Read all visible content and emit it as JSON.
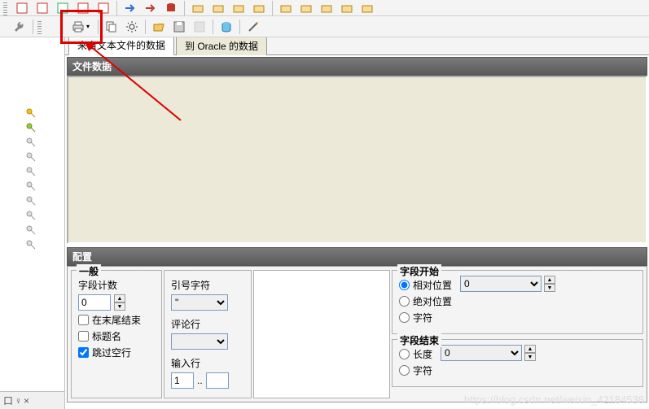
{
  "toolbar2": {
    "highlighted_button": "print-dropdown"
  },
  "tabs": {
    "from_text": "来自文本文件的数据",
    "to_oracle": "到 Oracle 的数据"
  },
  "sections": {
    "file_data": "文件数据",
    "config": "配置"
  },
  "config": {
    "general": {
      "legend": "一般",
      "field_count_label": "字段计数",
      "field_count_value": "0",
      "end_newline": "在末尾结束",
      "header_name": "标题名",
      "skip_blank": "跳过空行"
    },
    "col2": {
      "quote_label": "引号字符",
      "quote_value": "\"",
      "comment_label": "评论行",
      "comment_value": "",
      "input_label": "输入行",
      "input_value": "1",
      "input_sep": ".."
    },
    "field_start": {
      "legend": "字段开始",
      "opt_relative": "相对位置",
      "opt_absolute": "绝对位置",
      "opt_char": "字符",
      "value": "0"
    },
    "field_end": {
      "legend": "字段结束",
      "opt_length": "长度",
      "opt_char": "字符",
      "value": "0"
    }
  },
  "left_footer": {
    "chars": "口 ♀ ×"
  },
  "watermark": "https://blog.csdn.net/weixin_42184538"
}
